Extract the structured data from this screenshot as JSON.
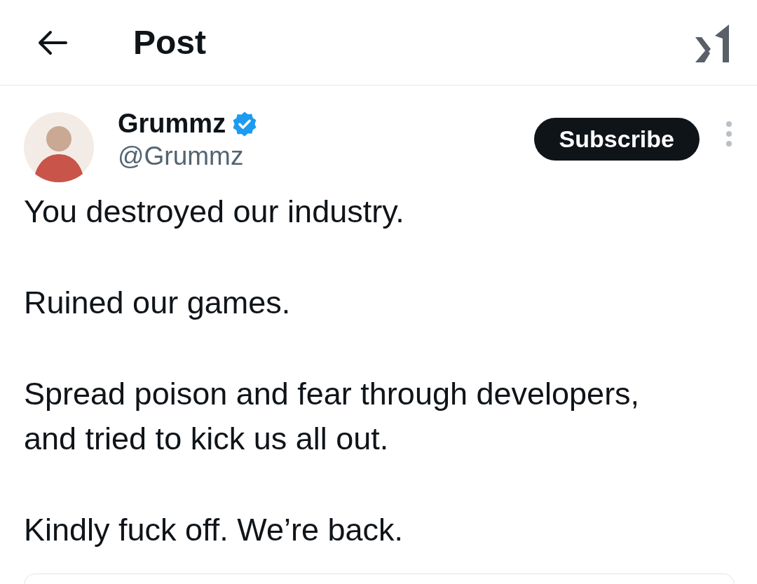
{
  "header": {
    "title": "Post"
  },
  "post": {
    "author": {
      "name": "Grummz",
      "verified": true,
      "handle": "@Grummz"
    },
    "subscribe_button": "Subscribe",
    "paragraphs": [
      "You destroyed our industry.",
      "Ruined our games.",
      "Spread poison and fear through developers, and tried to kick us all out.",
      "Kindly fuck off. We’re back."
    ]
  }
}
